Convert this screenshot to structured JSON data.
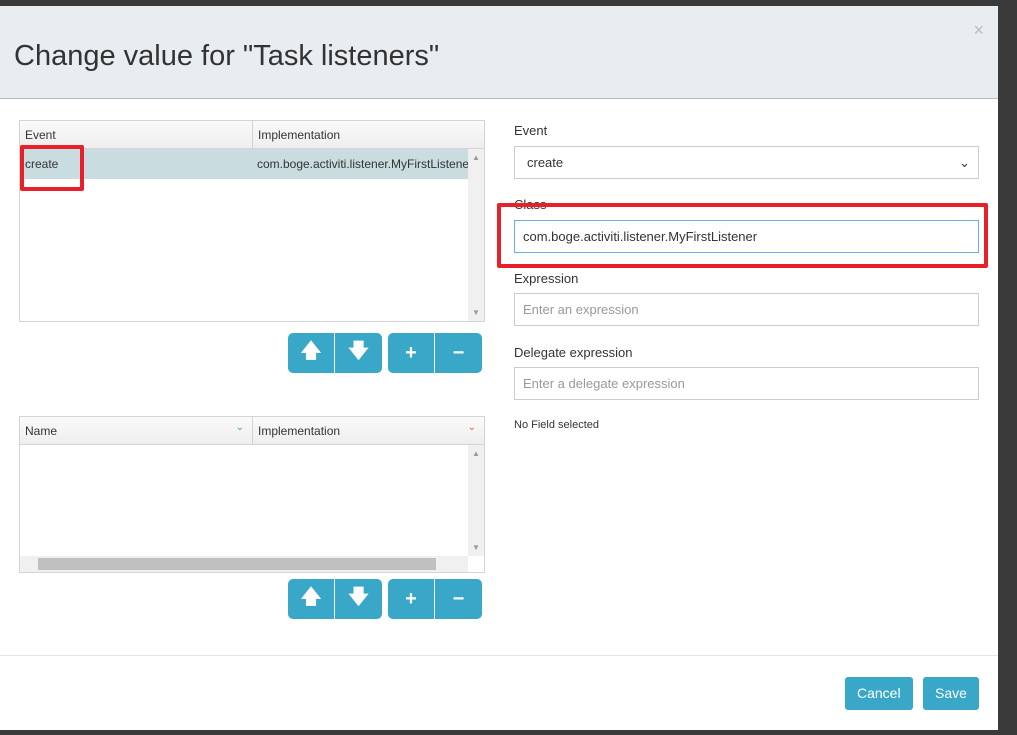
{
  "dialog": {
    "title": "Change value for \"Task listeners\"",
    "close": "×"
  },
  "listeners_grid": {
    "columns": [
      "Event",
      "Implementation"
    ],
    "rows": [
      {
        "event": "create",
        "implementation": "com.boge.activiti.listener.MyFirstListener"
      }
    ]
  },
  "fields_grid": {
    "columns": [
      "Name",
      "Implementation"
    ]
  },
  "buttons": {
    "up": "🡅",
    "down": "🡇",
    "add": "+",
    "remove": "−"
  },
  "form": {
    "event_label": "Event",
    "event_value": "create",
    "class_label": "Class",
    "class_value": "com.boge.activiti.listener.MyFirstListener",
    "expression_label": "Expression",
    "expression_placeholder": "Enter an expression",
    "delegate_label": "Delegate expression",
    "delegate_placeholder": "Enter a delegate expression",
    "no_field": "No Field selected"
  },
  "footer": {
    "cancel": "Cancel",
    "save": "Save"
  },
  "colors": {
    "accent": "#39a7c7",
    "highlight": "#e8202a",
    "selected_row": "#c9dce0"
  }
}
